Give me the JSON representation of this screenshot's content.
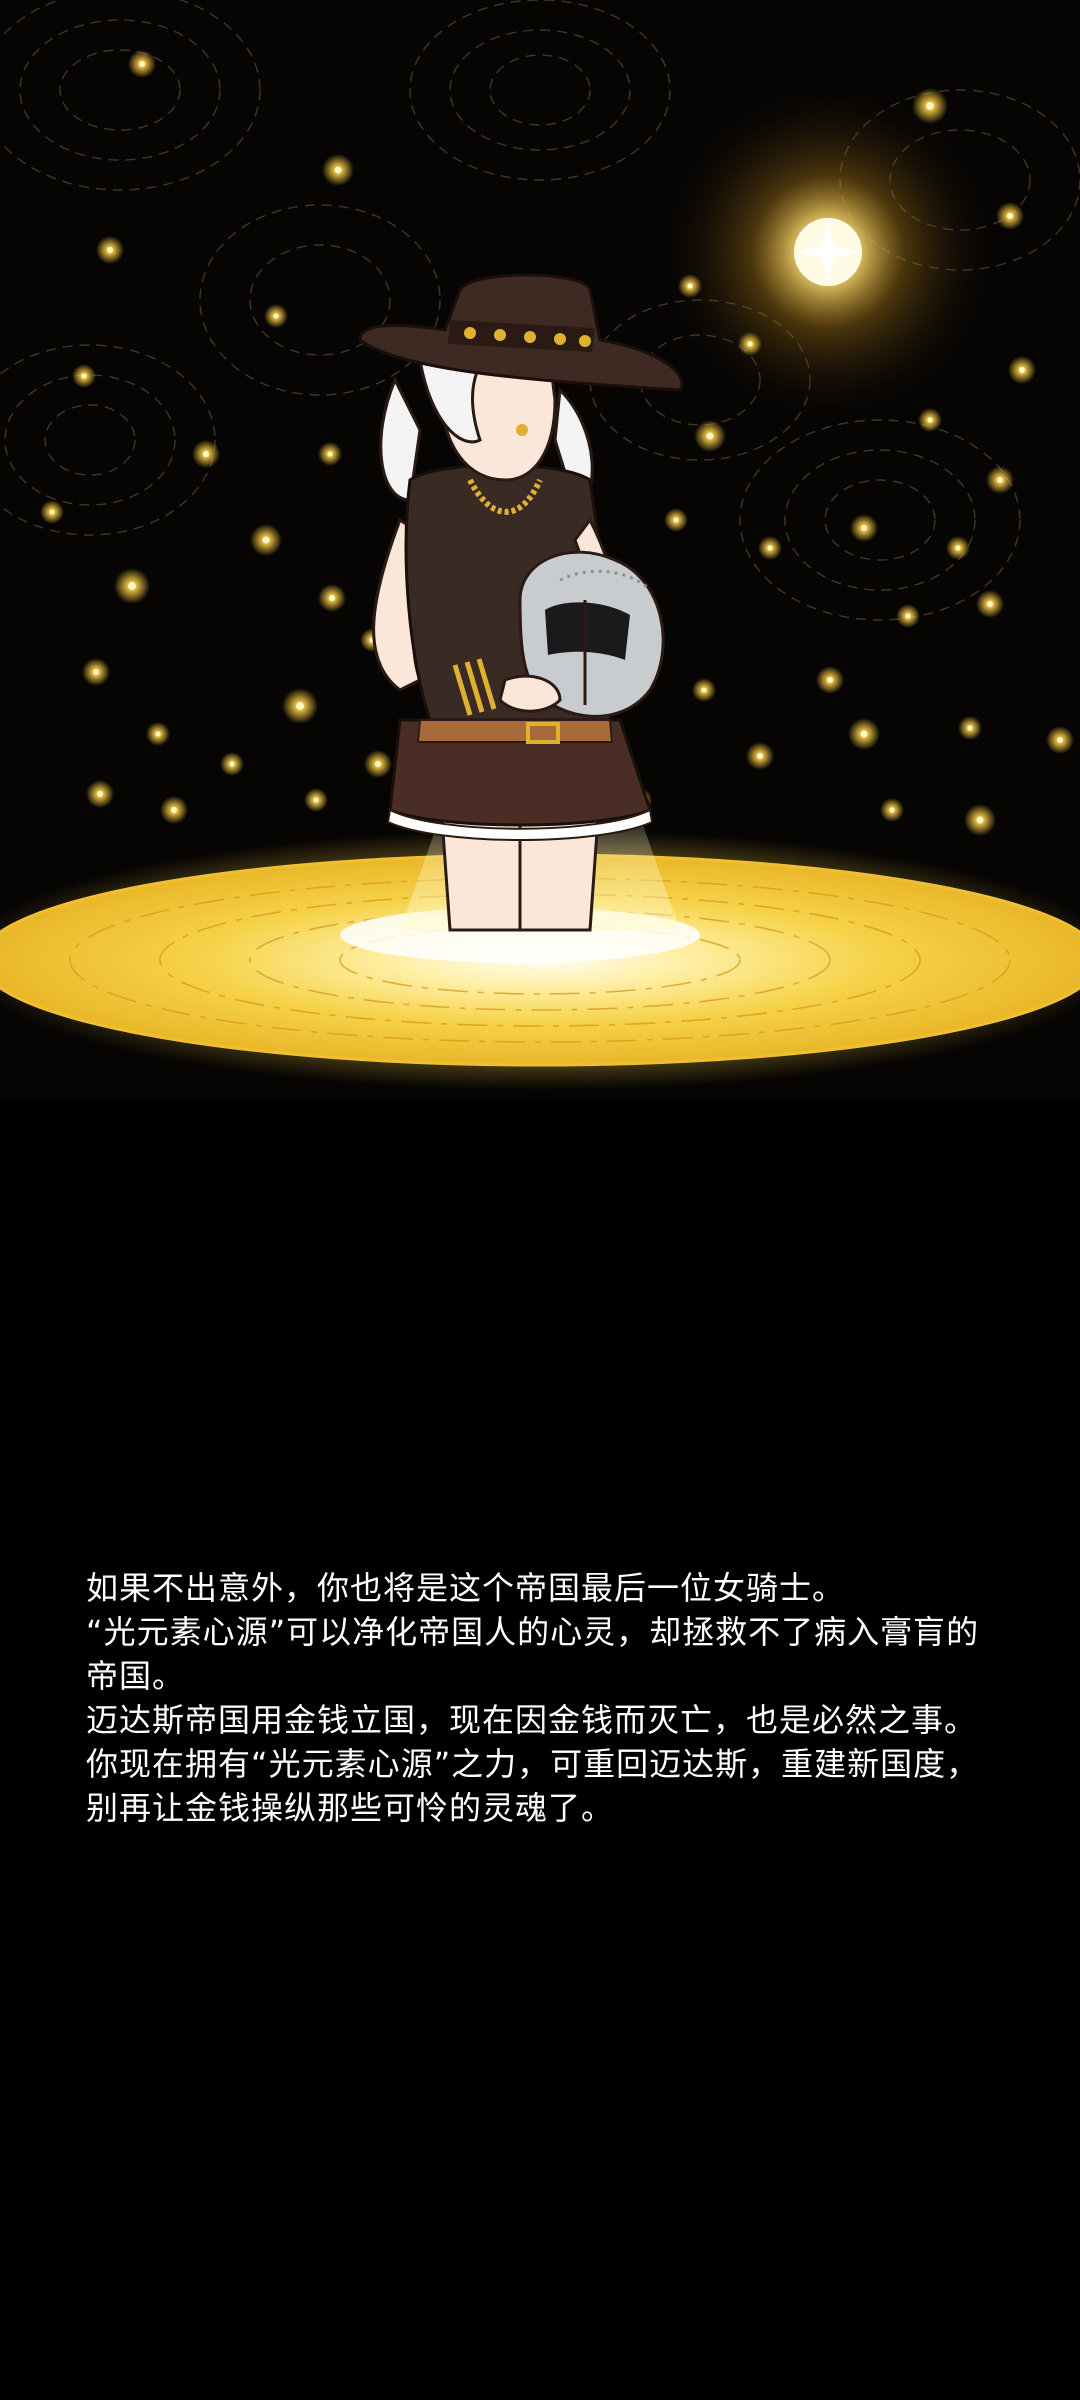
{
  "scene": {
    "description_icon": "knight-holding-helmet-illustration",
    "colors": {
      "background": "#000000",
      "sky": "#080604",
      "firefly": "#f5c842",
      "pool": "#f2cc38",
      "pool_edge": "#e6a623",
      "hat": "#3e2a22",
      "dress": "#3a2a24",
      "skin": "#fbe7d9",
      "hair": "#f4f4f4",
      "helmet": "#c9cccf",
      "gold": "#d4a92a"
    }
  },
  "story": {
    "lines": [
      "如果不出意外，你也将是这个帝国最后一位女骑士。",
      "“光元素心源”可以净化帝国人的心灵，却拯救不了病入膏肓的帝国。",
      "迈达斯帝国用金钱立国，现在因金钱而灭亡，也是必然之事。",
      "你现在拥有“光元素心源”之力，可重回迈达斯，重建新国度，",
      "别再让金钱操纵那些可怜的灵魂了。"
    ]
  }
}
